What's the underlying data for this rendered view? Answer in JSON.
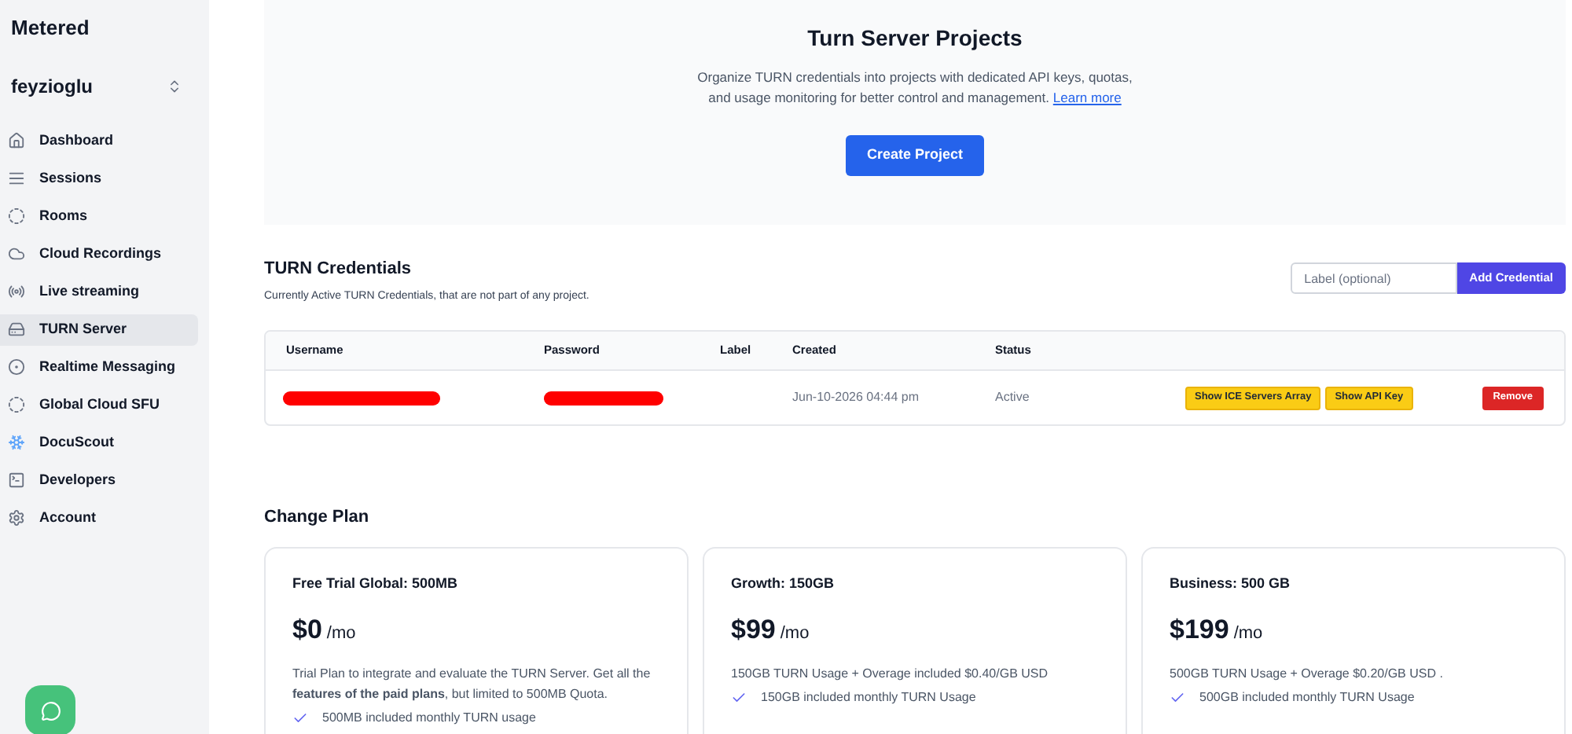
{
  "sidebar": {
    "brand": "Metered",
    "account": "feyzioglu",
    "items": [
      {
        "label": "Dashboard",
        "kind": "home",
        "selected": false
      },
      {
        "label": "Sessions",
        "kind": "lines",
        "selected": false
      },
      {
        "label": "Rooms",
        "kind": "dashed",
        "selected": false
      },
      {
        "label": "Cloud Recordings",
        "kind": "cloud",
        "selected": false
      },
      {
        "label": "Live streaming",
        "kind": "radio",
        "selected": false
      },
      {
        "label": "TURN Server",
        "kind": "server",
        "selected": true
      },
      {
        "label": "Realtime Messaging",
        "kind": "target",
        "selected": false
      },
      {
        "label": "Global Cloud SFU",
        "kind": "dashed",
        "selected": false
      },
      {
        "label": "DocuScout",
        "kind": "snowflake",
        "selected": false
      },
      {
        "label": "Developers",
        "kind": "terminal",
        "selected": false
      },
      {
        "label": "Account",
        "kind": "gear",
        "selected": false
      }
    ]
  },
  "projects": {
    "title": "Turn Server Projects",
    "description": "Organize TURN credentials into projects with dedicated API keys, quotas, and usage monitoring for better control and management.",
    "link": "Learn more",
    "button": "Create Project"
  },
  "credentials": {
    "title": "TURN Credentials",
    "subtitle": "Currently Active TURN Credentials, that are not part of any project.",
    "label_placeholder": "Label (optional)",
    "add_button": "Add Credential",
    "columns": [
      "Username",
      "Password",
      "Label",
      "Created",
      "Status"
    ],
    "rows": [
      {
        "username_redacted": true,
        "password_redacted": true,
        "created": "Jun-10-2026 04:44 pm",
        "status": "Active",
        "actions": [
          "Show ICE Servers Array",
          "Show API Key"
        ],
        "remove": "Remove"
      }
    ]
  },
  "plans": {
    "title": "Change Plan",
    "cards": [
      {
        "name": "Free Trial Global: 500MB",
        "price": "$0",
        "period": "/mo",
        "description": "Trial Plan to integrate and evaluate the TURN Server. Get all the **features of the paid plans**, but limited to 500MB Quota.",
        "features": [
          "500MB included monthly TURN usage"
        ]
      },
      {
        "name": "Growth: 150GB",
        "price": "$99",
        "period": "/mo",
        "description": "150GB TURN Usage + Overage included $0.40/GB USD",
        "features": [
          "150GB included monthly TURN Usage"
        ]
      },
      {
        "name": "Business: 500 GB",
        "price": "$199",
        "period": "/mo",
        "description": "500GB TURN Usage + Overage $0.20/GB USD .",
        "features": [
          "500GB included monthly TURN Usage"
        ]
      }
    ]
  }
}
